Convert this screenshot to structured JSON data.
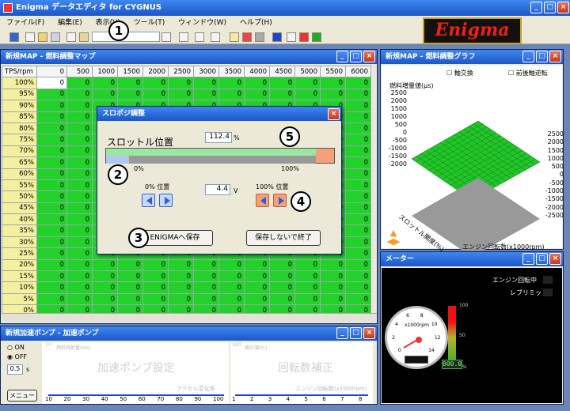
{
  "app": {
    "title": "Enigma データエディタ for CYGNUS"
  },
  "menu": [
    "ファイル(F)",
    "編集(E)",
    "表示(V)",
    "ツール(T)",
    "ウィンドウ(W)",
    "ヘルプ(H)"
  ],
  "logo": {
    "text": "Enigma"
  },
  "map_window": {
    "title": "新規MAP - 燃料調整マップ",
    "corner": "TPS/rpm",
    "columns": [
      "0",
      "500",
      "1000",
      "1500",
      "2000",
      "2500",
      "3000",
      "3500",
      "4000",
      "4500",
      "5000",
      "5500",
      "6000"
    ],
    "rows": [
      "100%",
      "95%",
      "90%",
      "85%",
      "80%",
      "75%",
      "70%",
      "65%",
      "60%",
      "55%",
      "50%",
      "45%",
      "40%",
      "35%",
      "30%",
      "25%",
      "20%",
      "15%",
      "10%",
      "5%",
      "0%"
    ],
    "cell_value": "0"
  },
  "graph_window": {
    "title": "新規MAP - 燃料調整グラフ",
    "check_axis": "軸交換",
    "check_fix": "前後軸逆転",
    "ylabel": "燃料増量値(μs)",
    "left_ticks": [
      "2500",
      "2000",
      "1500",
      "1000",
      "500",
      "0",
      "-500",
      "-1000",
      "-1500",
      "-2000"
    ],
    "right_ticks": [
      "2500",
      "2000",
      "1500",
      "1000",
      "500",
      "0",
      "-500",
      "-1000",
      "-1500",
      "-2000",
      "-2500"
    ],
    "rpm_label": "エンジン回転数(x1000rpm)",
    "tps_label": "スロットル開度(%)"
  },
  "dialog": {
    "title": "スロポジ調整",
    "throttle_label": "スロットル位置",
    "throttle_value": "112.4",
    "throttle_unit": "%",
    "throttle_level": 0.92,
    "calib_level": 0.1,
    "pct0": "0%",
    "pct100": "100%",
    "pos0_label": "0% 位置",
    "pos100_label": "100% 位置",
    "volt_value": "4.4",
    "volt_unit": "V",
    "save_button": "ENIGMAへ保存",
    "exit_button": "保存しないで終了"
  },
  "markers": [
    "1",
    "2",
    "3",
    "4",
    "5"
  ],
  "meter_window": {
    "title": "メーター",
    "engine_running": "エンジン回転中",
    "rev_limit": "レブリミット",
    "tach_label": "x1000rpm",
    "tach_ticks": [
      "0",
      "2",
      "4",
      "6",
      "8",
      "10",
      "12",
      "14"
    ],
    "digital": "000.0",
    "bar_top": "100",
    "bar_mid": "50",
    "bar_bottom": "0%"
  },
  "pump_window": {
    "title": "新規加速ポンプ - 加速ポンプ",
    "on": "ON",
    "off": "OFF",
    "spin_value": "0.5",
    "spin_unit": "s",
    "menu_button": "メニュー",
    "chart1_ylabel": "燃料噴射量(ms)",
    "chart1_watermark": "加速ポンプ設定",
    "chart1_xlabel": "アクセル変化率",
    "chart1_top": "10",
    "chart1_ticks": [
      "10",
      "20",
      "30",
      "40",
      "50",
      "60",
      "70",
      "80",
      "90",
      "100"
    ],
    "chart2_ylabel": "補正値(%)",
    "chart2_watermark": "回転数補正",
    "chart2_xlabel": "エンジン回転数(x1000rpm)",
    "chart2_top": "100",
    "chart2_ticks": [
      "1",
      "2",
      "3",
      "4",
      "5",
      "6",
      "7",
      "8"
    ]
  }
}
